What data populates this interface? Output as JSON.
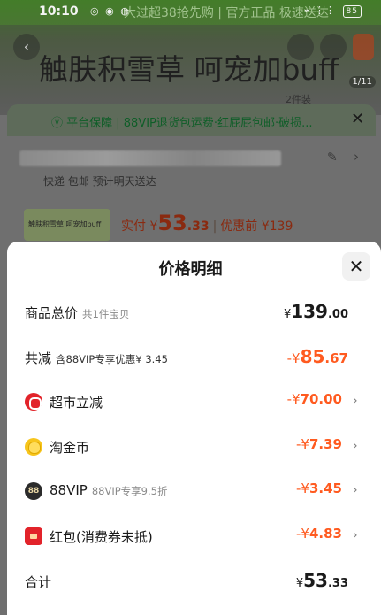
{
  "status_bar": {
    "time": "10:10",
    "left_icons": "粘 👁 ⚙",
    "right_icons": "🔕 ☰ ⁙⁙",
    "battery": "85"
  },
  "background": {
    "banner_text": "大过超38抢先购 | 官方正品 极速送达",
    "hero_title": "触肤积雪草 呵宠加buff",
    "hero_tag": "2件装",
    "hero_count": "1/11",
    "guarantee_text": "ⓥ 平台保障 | 88VIP退货包运费·红屁屁包邮·破损...",
    "shipping_text": "快递 包邮  预计明天送达",
    "thumb_text": "触肤积雪草 呵宠加buff",
    "price_label": "实付 ¥",
    "price_int": "53",
    "price_dec": ".33",
    "price_orig": "优惠前 ¥139"
  },
  "sheet": {
    "title": "价格明细",
    "rows": [
      {
        "label": "商品总价",
        "sub": "共1件宝贝",
        "yen": "¥",
        "int": "139",
        "dec": ".00"
      },
      {
        "label": "共减",
        "sub": "含88VIP专享优惠¥ 3.45",
        "yen": "-¥",
        "int": "85",
        "dec": ".67"
      },
      {
        "label": "超市立减",
        "yen": "-¥",
        "int": "70",
        "dec": ".00",
        "icon": "supermarket-icon"
      },
      {
        "label": "淘金币",
        "yen": "-¥",
        "int": "7",
        "dec": ".39",
        "icon": "gold-coin-icon"
      },
      {
        "label": "88VIP",
        "sub": "88VIP专享9.5折",
        "yen": "-¥",
        "int": "3",
        "dec": ".45",
        "icon": "88vip-icon",
        "icon_text": "88"
      },
      {
        "label": "红包(消费券未抵)",
        "yen": "-¥",
        "int": "4",
        "dec": ".83",
        "icon": "red-packet-icon"
      },
      {
        "label": "合计",
        "yen": "¥",
        "int": "53",
        "dec": ".33"
      }
    ]
  },
  "colors": {
    "discount": "#ff5a1f",
    "text": "#1a1a1a",
    "muted": "#8a8a8a"
  }
}
